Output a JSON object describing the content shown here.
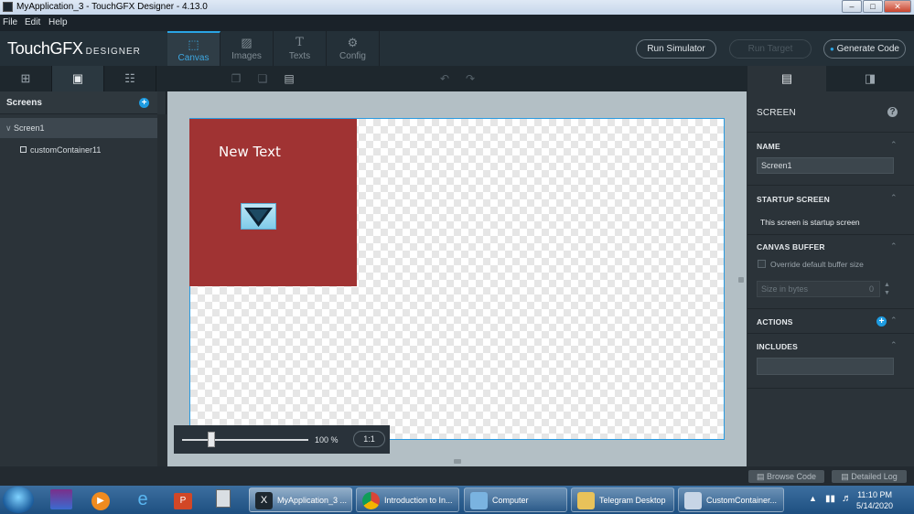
{
  "window": {
    "title": "MyApplication_3 - TouchGFX Designer - 4.13.0",
    "controls": [
      "–",
      "□",
      "✕"
    ]
  },
  "menu": [
    "File",
    "Edit",
    "Help"
  ],
  "brand": {
    "name": "TouchGFX",
    "suffix": "DESIGNER"
  },
  "tabs": [
    {
      "label": "Canvas",
      "icon": "canvas-icon",
      "glyph": "⬚"
    },
    {
      "label": "Images",
      "icon": "image-icon",
      "glyph": "▨"
    },
    {
      "label": "Texts",
      "icon": "text-icon",
      "glyph": "T"
    },
    {
      "label": "Config",
      "icon": "gears-icon",
      "glyph": "⚙"
    }
  ],
  "actions": {
    "run_simulator": "Run Simulator",
    "run_target": "Run Target",
    "generate_code": "Generate Code"
  },
  "left_panel": {
    "title": "Screens",
    "tree": [
      {
        "label": "Screen1",
        "expander": "∨"
      },
      {
        "label": "customContainer11"
      }
    ]
  },
  "canvas": {
    "widget_text": "New Text",
    "container_color": "#a03333",
    "zoom": "100 %",
    "zoom_reset": "1:1"
  },
  "right_panel": {
    "header": "SCREEN",
    "help": "?",
    "sections": {
      "name": {
        "label": "NAME",
        "value": "Screen1"
      },
      "startup": {
        "label": "STARTUP SCREEN",
        "text": "This screen is startup screen"
      },
      "buffer": {
        "label": "CANVAS BUFFER",
        "checkbox": "Override default buffer size",
        "placeholder": "Size in bytes",
        "value": "0"
      },
      "actions": {
        "label": "ACTIONS"
      },
      "includes": {
        "label": "INCLUDES"
      }
    }
  },
  "status": {
    "browse_code": "Browse Code",
    "detailed_log": "Detailed Log"
  },
  "taskbar": {
    "tasks": [
      {
        "label": "MyApplication_3 ..."
      },
      {
        "label": "Introduction to In..."
      },
      {
        "label": "Computer"
      },
      {
        "label": "Telegram Desktop"
      },
      {
        "label": "CustomContainer..."
      }
    ],
    "clock_time": "11:10 PM",
    "clock_date": "5/14/2020"
  }
}
